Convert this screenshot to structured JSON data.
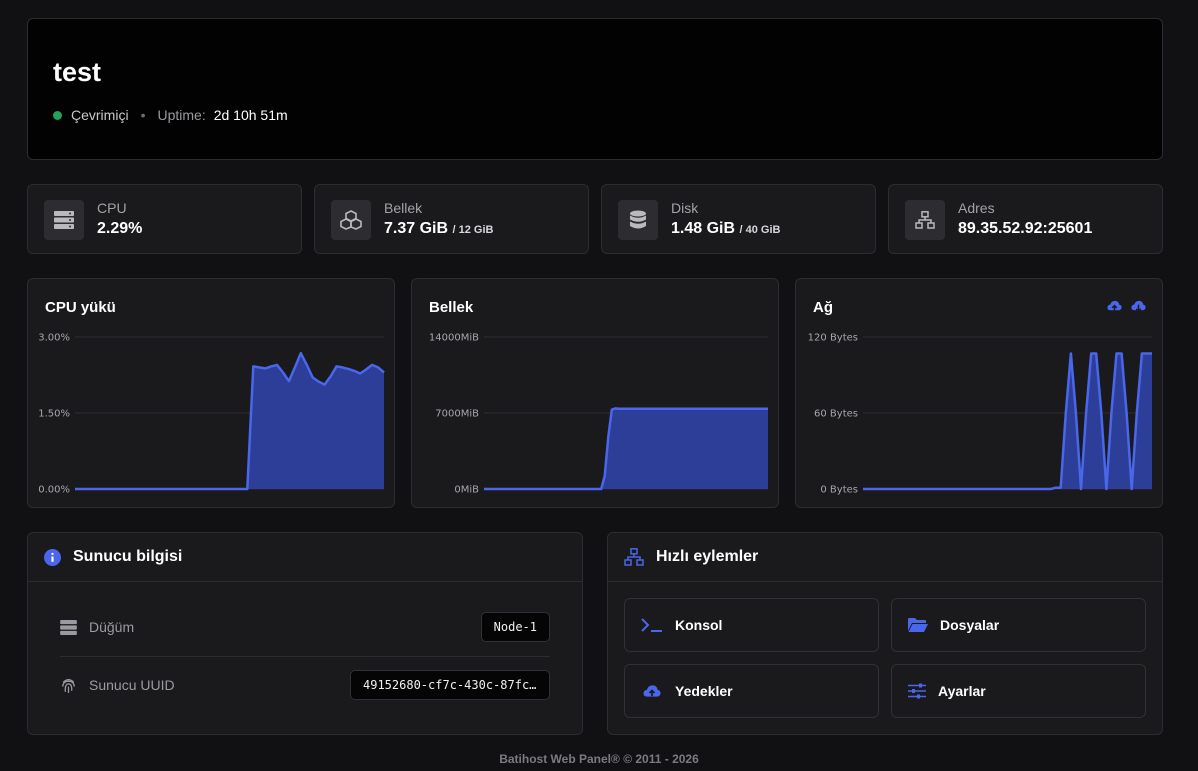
{
  "server": {
    "name": "test",
    "status": "Çevrimiçi",
    "separator": "•",
    "uptime_label": "Uptime:",
    "uptime_value": "2d 10h 51m"
  },
  "stats": {
    "cpu": {
      "label": "CPU",
      "value": "2.29%"
    },
    "memory": {
      "label": "Bellek",
      "value": "7.37 GiB",
      "sub": "/ 12 GiB"
    },
    "disk": {
      "label": "Disk",
      "value": "1.48 GiB",
      "sub": "/ 40 GiB"
    },
    "address": {
      "label": "Adres",
      "value": "89.35.52.92:25601"
    }
  },
  "colors": {
    "accent": "#4a66ea",
    "fill": "#2f43a6",
    "online": "#22a35a"
  },
  "chart_data": [
    {
      "type": "area",
      "title": "CPU yükü",
      "ylim": [
        0,
        3
      ],
      "yticks": [
        "3.00%",
        "1.50%",
        "0.00%"
      ],
      "x": [
        0,
        1,
        2,
        3,
        4,
        5,
        6,
        7,
        8,
        9,
        10,
        11,
        12,
        13,
        14,
        15,
        16,
        17,
        18,
        19,
        20,
        21,
        22,
        23,
        24,
        25,
        26,
        27,
        28,
        29,
        30,
        31,
        32,
        33,
        34,
        35,
        36,
        37,
        38,
        39,
        40,
        41,
        42,
        43,
        44,
        45,
        46,
        47,
        48,
        49,
        50,
        51,
        52,
        53,
        54,
        55,
        56,
        57,
        58,
        59
      ],
      "values": [
        0,
        0,
        0,
        0,
        0,
        0,
        0,
        0,
        0,
        0,
        0,
        0,
        0,
        0,
        0,
        0,
        0,
        0,
        0,
        0,
        0,
        0,
        0,
        0,
        0,
        0,
        0,
        0,
        0,
        0,
        2.42,
        2.4,
        2.38,
        2.42,
        2.45,
        2.3,
        2.13,
        2.4,
        2.68,
        2.45,
        2.2,
        2.12,
        2.06,
        2.22,
        2.42,
        2.4,
        2.37,
        2.33,
        2.28,
        2.36,
        2.45,
        2.4,
        2.3
      ],
      "grid": true
    },
    {
      "type": "area",
      "title": "Bellek",
      "ylim": [
        0,
        14000
      ],
      "yticks": [
        "14000MiB",
        "7000MiB",
        "0MiB"
      ],
      "values": [
        0,
        0,
        0,
        0,
        0,
        0,
        0,
        0,
        0,
        0,
        0,
        0,
        0,
        0,
        0,
        0,
        0,
        0,
        0,
        0,
        0,
        0,
        0,
        0,
        0,
        0,
        0,
        0,
        0,
        0,
        0,
        0,
        0,
        0,
        1200,
        4800,
        7300,
        7420,
        7400,
        7400,
        7400,
        7400,
        7400,
        7400,
        7400,
        7400,
        7400,
        7400,
        7400,
        7400,
        7400,
        7400,
        7400,
        7400,
        7400,
        7400,
        7400,
        7400,
        7400,
        7400,
        7400,
        7400,
        7400,
        7400,
        7400,
        7400,
        7400,
        7400,
        7400,
        7400,
        7400,
        7400,
        7400,
        7400,
        7400,
        7400,
        7400,
        7400,
        7400,
        7400,
        7400
      ],
      "grid": true
    },
    {
      "type": "area",
      "title": "Ağ",
      "ylim": [
        0,
        120
      ],
      "yticks": [
        "120 Bytes",
        "60 Bytes",
        "0 Bytes"
      ],
      "values": [
        0,
        0,
        0,
        0,
        0,
        0,
        0,
        0,
        0,
        0,
        0,
        0,
        0,
        0,
        0,
        0,
        0,
        0,
        0,
        0,
        0,
        0,
        0,
        0,
        0,
        0,
        0,
        0,
        0,
        0,
        0,
        0,
        0,
        0,
        0,
        0,
        0,
        0,
        1,
        1,
        60,
        107,
        60,
        0,
        60,
        107,
        107,
        60,
        0,
        60,
        107,
        107,
        60,
        0,
        60,
        107,
        107,
        107
      ],
      "grid": true
    }
  ],
  "server_info": {
    "title": "Sunucu bilgisi",
    "rows": [
      {
        "label": "Düğüm",
        "value": "Node-1"
      },
      {
        "label": "Sunucu UUID",
        "value": "49152680-cf7c-430c-87fc-…"
      }
    ]
  },
  "quick_actions": {
    "title": "Hızlı eylemler",
    "items": [
      {
        "label": "Konsol",
        "icon": "terminal-icon"
      },
      {
        "label": "Dosyalar",
        "icon": "folder-icon"
      },
      {
        "label": "Yedekler",
        "icon": "cloud-upload-icon"
      },
      {
        "label": "Ayarlar",
        "icon": "sliders-icon"
      }
    ]
  },
  "footer": "Batihost Web Panel® © 2011 - 2026"
}
